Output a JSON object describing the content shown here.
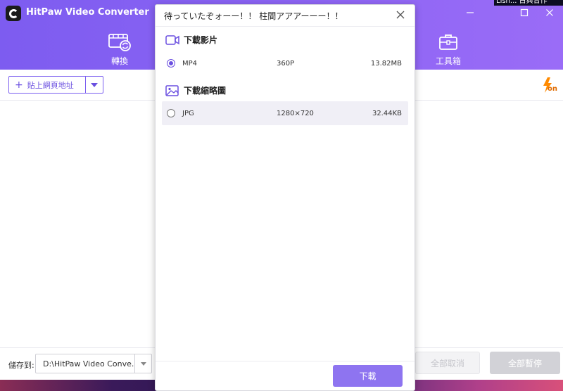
{
  "app": {
    "title": "HitPaw Video Converter"
  },
  "external_window": {
    "title": "Lish... 古典合作"
  },
  "nav": {
    "convert_label": "轉換",
    "toolbox_label": "工具箱"
  },
  "toolbar": {
    "paste_url_label": "貼上網頁地址",
    "acceleration_badge": "on"
  },
  "bottom": {
    "save_to_label": "儲存到:",
    "save_path": "D:\\HitPaw Video Conve...",
    "cancel_all_label": "全部取消",
    "pause_all_label": "全部暫停"
  },
  "modal": {
    "title": "待っていたぞォーー！！ 柱間アアアーーー！！",
    "video_section_label": "下載影片",
    "thumbnail_section_label": "下載縮略圖",
    "video_options": [
      {
        "format": "MP4",
        "resolution": "360P",
        "size": "13.82MB",
        "selected": true
      }
    ],
    "thumbnail_options": [
      {
        "format": "JPG",
        "resolution": "1280×720",
        "size": "32.44KB",
        "selected": false
      }
    ],
    "download_label": "下載"
  },
  "colors": {
    "accent": "#7b5ff0",
    "header_gradient_start": "#7d5cf0",
    "header_gradient_end": "#9a6cf7",
    "download_button": "#8e74f0"
  }
}
